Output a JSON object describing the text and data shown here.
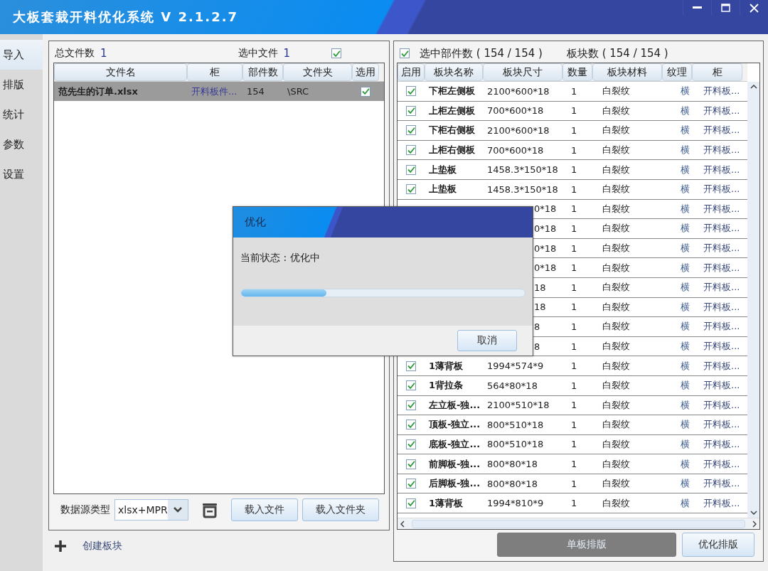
{
  "window": {
    "title": "大板套裁开料优化系统 V 2.1.2.7"
  },
  "sidebar": {
    "items": [
      {
        "label": "导入",
        "selected": true
      },
      {
        "label": "排版",
        "selected": false
      },
      {
        "label": "统计",
        "selected": false
      },
      {
        "label": "参数",
        "selected": false
      },
      {
        "label": "设置",
        "selected": false
      }
    ]
  },
  "files_panel": {
    "total_label": "总文件数",
    "total": "1",
    "selected_label": "选中文件",
    "selected_count": "1",
    "select_all_checked": true,
    "table": {
      "columns": [
        "文件名",
        "柜",
        "部件数",
        "文件夹",
        "选用"
      ],
      "rows": [
        {
          "name": "范先生的订单.xlsx",
          "cabinet": "开料板件...",
          "parts": "154",
          "folder": "\\SRC",
          "checked": true,
          "selected": true
        }
      ]
    },
    "source_label": "数据源类型",
    "source_value": "xlsx+MPR",
    "buttons": [
      "载入文件",
      "载入文件夹"
    ]
  },
  "create_link": "创建板块",
  "parts_panel": {
    "select_all_checked": true,
    "selected_parts": "选中部件数 ( 154 / 154 )",
    "boards": "板块数 ( 154 / 154 )",
    "table": {
      "columns": [
        "启用",
        "板块名称",
        "板块尺寸",
        "数量",
        "板块材料",
        "纹理",
        "柜"
      ],
      "rows": [
        {
          "covered": false,
          "enabled": true,
          "name": "下柜左侧板",
          "size": "2100*600*18",
          "qty": "1",
          "material": "白裂纹",
          "grain": "横",
          "cabinet": "开料板..."
        },
        {
          "covered": false,
          "enabled": true,
          "name": "上柜左侧板",
          "size": "700*600*18",
          "qty": "1",
          "material": "白裂纹",
          "grain": "横",
          "cabinet": "开料板..."
        },
        {
          "covered": false,
          "enabled": true,
          "name": "下柜右侧板",
          "size": "2100*600*18",
          "qty": "1",
          "material": "白裂纹",
          "grain": "横",
          "cabinet": "开料板..."
        },
        {
          "covered": false,
          "enabled": true,
          "name": "上柜右侧板",
          "size": "700*600*18",
          "qty": "1",
          "material": "白裂纹",
          "grain": "横",
          "cabinet": "开料板..."
        },
        {
          "covered": false,
          "enabled": true,
          "name": "上垫板",
          "size": "1458.3*150*18",
          "qty": "1",
          "material": "白裂纹",
          "grain": "横",
          "cabinet": "开料板..."
        },
        {
          "covered": false,
          "enabled": true,
          "name": "上垫板",
          "size": "1458.3*150*18",
          "qty": "1",
          "material": "白裂纹",
          "grain": "横",
          "cabinet": "开料板..."
        },
        {
          "covered": true,
          "size": "0*18",
          "qty": "1",
          "material": "白裂纹",
          "grain": "横",
          "cabinet": "开料板..."
        },
        {
          "covered": true,
          "size": "0*18",
          "qty": "1",
          "material": "白裂纹",
          "grain": "横",
          "cabinet": "开料板..."
        },
        {
          "covered": true,
          "size": "0*18",
          "qty": "1",
          "material": "白裂纹",
          "grain": "横",
          "cabinet": "开料板..."
        },
        {
          "covered": true,
          "size": "0*18",
          "qty": "1",
          "material": "白裂纹",
          "grain": "横",
          "cabinet": "开料板..."
        },
        {
          "covered": true,
          "size": "18",
          "qty": "1",
          "material": "白裂纹",
          "grain": "横",
          "cabinet": "开料板..."
        },
        {
          "covered": true,
          "size": "18",
          "qty": "1",
          "material": "白裂纹",
          "grain": "横",
          "cabinet": "开料板..."
        },
        {
          "covered": true,
          "size": "8",
          "qty": "1",
          "material": "白裂纹",
          "grain": "横",
          "cabinet": "开料板..."
        },
        {
          "covered": true,
          "size": "8",
          "qty": "1",
          "material": "白裂纹",
          "grain": "横",
          "cabinet": "开料板..."
        },
        {
          "covered": false,
          "enabled": true,
          "name": "1薄背板",
          "size": "1994*574*9",
          "qty": "1",
          "material": "白裂纹",
          "grain": "横",
          "cabinet": "开料板..."
        },
        {
          "covered": false,
          "enabled": true,
          "name": "1背拉条",
          "size": "564*80*18",
          "qty": "1",
          "material": "白裂纹",
          "grain": "横",
          "cabinet": "开料板..."
        },
        {
          "covered": false,
          "enabled": true,
          "name": "左立板-独...",
          "size": "2100*510*18",
          "qty": "1",
          "material": "白裂纹",
          "grain": "横",
          "cabinet": "开料板..."
        },
        {
          "covered": false,
          "enabled": true,
          "name": "顶板-独立...",
          "size": "800*510*18",
          "qty": "1",
          "material": "白裂纹",
          "grain": "横",
          "cabinet": "开料板..."
        },
        {
          "covered": false,
          "enabled": true,
          "name": "底板-独立...",
          "size": "800*510*18",
          "qty": "1",
          "material": "白裂纹",
          "grain": "横",
          "cabinet": "开料板..."
        },
        {
          "covered": false,
          "enabled": true,
          "name": "前脚板-独...",
          "size": "800*80*18",
          "qty": "1",
          "material": "白裂纹",
          "grain": "横",
          "cabinet": "开料板..."
        },
        {
          "covered": false,
          "enabled": true,
          "name": "后脚板-独...",
          "size": "800*80*18",
          "qty": "1",
          "material": "白裂纹",
          "grain": "横",
          "cabinet": "开料板..."
        },
        {
          "covered": false,
          "enabled": true,
          "name": "1薄背板",
          "size": "1994*810*9",
          "qty": "1",
          "material": "白裂纹",
          "grain": "横",
          "cabinet": "开料板..."
        }
      ]
    },
    "buttons": [
      {
        "label": "单板排版",
        "disabled": true
      },
      {
        "label": "优化排版",
        "disabled": false
      }
    ]
  },
  "dialog": {
    "title": "优化",
    "status": "当前状态 : 优化中",
    "level": 0.3,
    "button": "取消"
  }
}
